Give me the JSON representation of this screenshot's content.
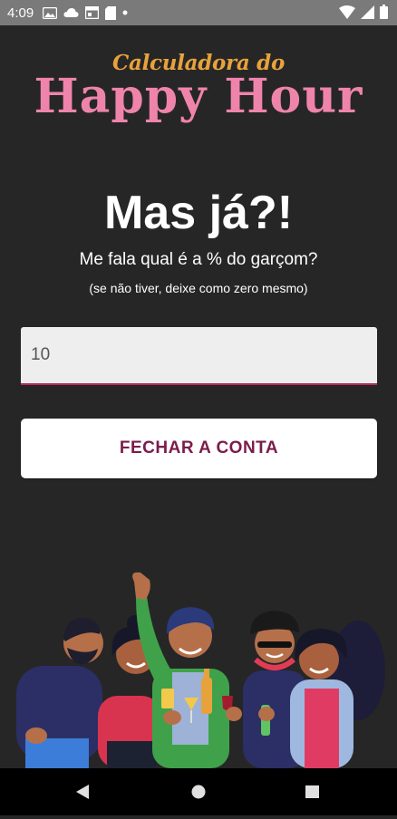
{
  "status_bar": {
    "time": "4:09",
    "icons": [
      "photo-icon",
      "cloud-icon",
      "calendar-icon",
      "sd-card-icon",
      "dot-icon"
    ],
    "right_icons": [
      "wifi-icon",
      "signal-icon",
      "battery-icon"
    ]
  },
  "app": {
    "title_small": "Calculadora do",
    "title_big": "Happy Hour"
  },
  "main": {
    "heading": "Mas já?!",
    "question": "Me fala qual é a % do garçom?",
    "hint": "(se não tiver, deixe como zero mesmo)",
    "tip_input_value": "10",
    "close_button_label": "FECHAR A CONTA"
  },
  "nav": {
    "icons": [
      "back-icon",
      "home-icon",
      "recents-icon"
    ]
  },
  "colors": {
    "background": "#262626",
    "title_small": "#e8a23c",
    "title_big": "#ef84ab",
    "button_text": "#7b1c4b",
    "input_underline": "#ba2a5c"
  }
}
